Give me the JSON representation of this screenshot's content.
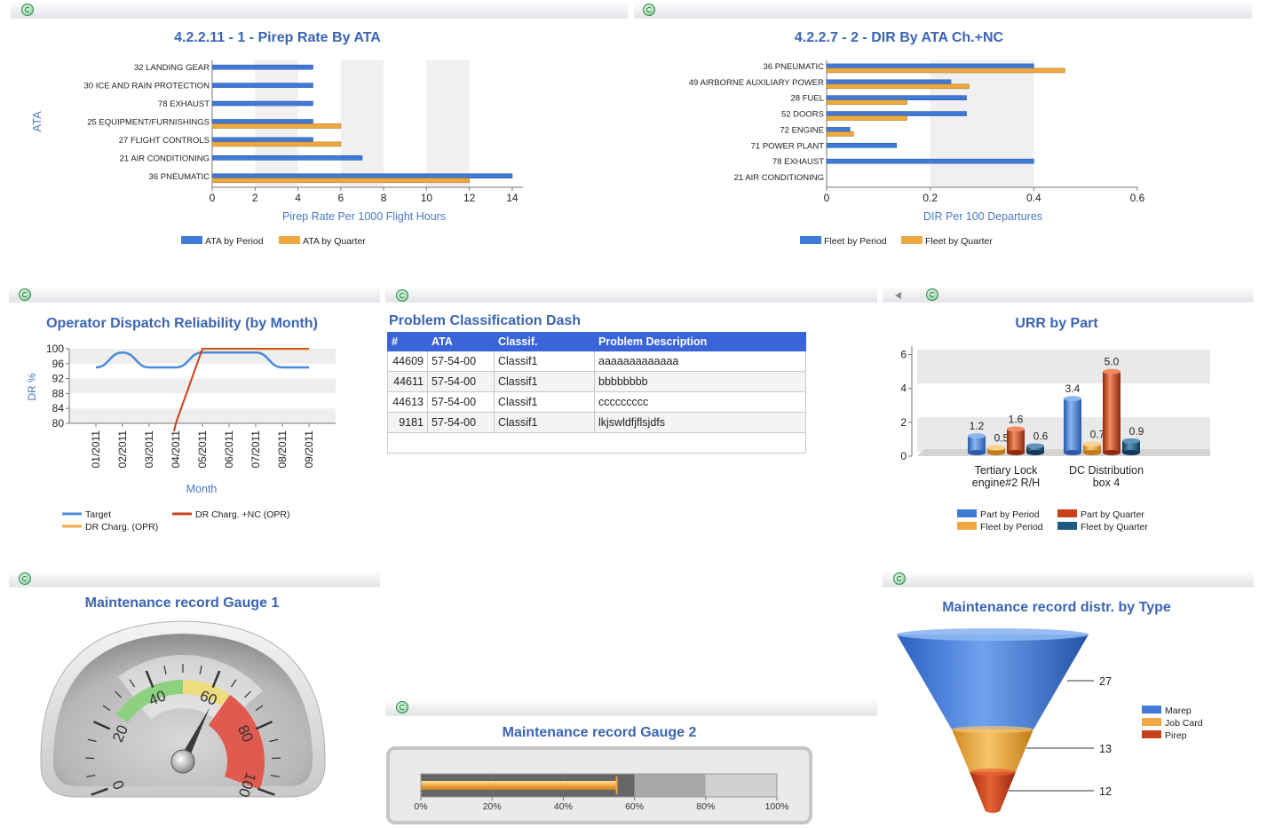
{
  "colors": {
    "title": "#3a65b4",
    "blue": "#3f7ad6",
    "orange": "#f0a840",
    "red": "#c9401a",
    "darkblue": "#1f5a84",
    "axis": "#4a78c4"
  },
  "pirep": {
    "title": "4.2.2.11 - 1 - Pirep Rate By ATA",
    "ylabel": "ATA",
    "xlabel": "Pirep Rate Per 1000 Flight Hours",
    "legend": [
      "ATA by Period",
      "ATA by Quarter"
    ],
    "chart_data": {
      "type": "bar",
      "categories": [
        "32 LANDING GEAR",
        "30 ICE AND RAIN PROTECTION",
        "78 EXHAUST",
        "25 EQUIPMENT/FURNISHINGS",
        "27 FLIGHT CONTROLS",
        "21 AIR CONDITIONING",
        "36 PNEUMATIC"
      ],
      "series": [
        {
          "name": "ATA by Period",
          "values": [
            4.7,
            4.7,
            4.7,
            4.7,
            4.7,
            7.0,
            14.0
          ]
        },
        {
          "name": "ATA by Quarter",
          "values": [
            0,
            0,
            0,
            6.0,
            6.0,
            0,
            12.0
          ]
        }
      ],
      "ticks": [
        "0",
        "2",
        "4",
        "6",
        "8",
        "10",
        "12",
        "14"
      ],
      "xlim": [
        0,
        14.5
      ]
    }
  },
  "dir": {
    "title": "4.2.2.7 - 2 - DIR By ATA Ch.+NC",
    "xlabel": "DIR Per 100 Departures",
    "legend": [
      "Fleet by Period",
      "Fleet by Quarter"
    ],
    "chart_data": {
      "type": "bar",
      "categories": [
        "36 PNEUMATIC",
        "49 AIRBORNE AUXILIARY POWER",
        "28 FUEL",
        "52 DOORS",
        "72 ENGINE",
        "71 POWER PLANT",
        "78 EXHAUST",
        "21 AIR CONDITIONING"
      ],
      "series": [
        {
          "name": "Fleet by Period",
          "values": [
            0.4,
            0.24,
            0.27,
            0.27,
            0.045,
            0.135,
            0.4,
            0
          ]
        },
        {
          "name": "Fleet by Quarter",
          "values": [
            0.46,
            0.275,
            0.155,
            0.155,
            0.052,
            0,
            0,
            0
          ]
        }
      ],
      "ticks": [
        "0",
        "0.2",
        "0.4",
        "0.6"
      ],
      "xlim": [
        0,
        0.6
      ]
    }
  },
  "odr": {
    "title": "Operator Dispatch Reliability (by Month)",
    "ylabel": "DR %",
    "xlabel": "Month",
    "legend": [
      "Target",
      "DR Charg. +NC (OPR)",
      "DR Charg. (OPR)"
    ],
    "chart_data": {
      "type": "line",
      "categories": [
        "01/2011",
        "02/2011",
        "03/2011",
        "04/2011",
        "05/2011",
        "06/2011",
        "07/2011",
        "08/2011",
        "09/2011"
      ],
      "yticks": [
        "100",
        "96",
        "92",
        "88",
        "84",
        "80"
      ],
      "ylim": [
        80,
        100
      ],
      "series": [
        {
          "name": "Target",
          "values": [
            95,
            99,
            95,
            95,
            99,
            99,
            99,
            95,
            95
          ]
        },
        {
          "name": "DR Charg. +NC (OPR)",
          "values": [
            null,
            null,
            null,
            80,
            100,
            100,
            100,
            100,
            100
          ]
        },
        {
          "name": "DR Charg. (OPR)",
          "values": [
            null,
            null,
            null,
            null,
            100,
            100,
            100,
            100,
            100
          ]
        }
      ]
    }
  },
  "problems": {
    "title": "Problem Classification Dash",
    "columns": [
      "#",
      "ATA",
      "Classif.",
      "Problem Description"
    ],
    "rows": [
      [
        "44609",
        "57-54-00",
        "Classif1",
        "aaaaaaaaaaaaa"
      ],
      [
        "44611",
        "57-54-00",
        "Classif1",
        "bbbbbbbb"
      ],
      [
        "44613",
        "57-54-00",
        "Classif1",
        "ccccccccc"
      ],
      [
        "9181",
        "57-54-00",
        "Classif1",
        "lkjswldfjflsjdfs"
      ]
    ]
  },
  "urr": {
    "title": "URR by Part",
    "legend": [
      "Part by Period",
      "Part by Quarter",
      "Fleet by Period",
      "Fleet by Quarter"
    ],
    "chart_data": {
      "type": "bar",
      "categories": [
        "Tertiary Lock engine#2 R/H",
        "DC Distribution box 4"
      ],
      "category_lines": [
        [
          "Tertiary Lock",
          "engine#2 R/H"
        ],
        [
          "DC Distribution",
          "box 4"
        ]
      ],
      "yticks": [
        "6",
        "4",
        "2",
        "0"
      ],
      "ylim": [
        0,
        6.5
      ],
      "series": [
        {
          "name": "Part by Period",
          "values": [
            1.2,
            3.4
          ],
          "labels": [
            "1.2",
            "3.4"
          ]
        },
        {
          "name": "Fleet by Period",
          "values": [
            0.5,
            0.7
          ],
          "labels": [
            "0.5",
            "0.7"
          ]
        },
        {
          "name": "Part by Quarter",
          "values": [
            1.6,
            5.0
          ],
          "labels": [
            "1.6",
            "5.0"
          ]
        },
        {
          "name": "Fleet by Quarter",
          "values": [
            0.6,
            0.9
          ],
          "labels": [
            "0.6",
            "0.9"
          ]
        }
      ]
    }
  },
  "gauge1": {
    "title": "Maintenance record Gauge 1",
    "ticks": [
      "0",
      "20",
      "40",
      "60",
      "80",
      "100"
    ],
    "value": 62
  },
  "gauge2": {
    "title": "Maintenance record Gauge 2",
    "ticks": [
      "0%",
      "20%",
      "40%",
      "60%",
      "80%",
      "100%"
    ],
    "value_percent": 55
  },
  "funnel": {
    "title": "Maintenance record distr. by Type",
    "legend": [
      "Marep",
      "Job Card",
      "Pirep"
    ],
    "chart_data": {
      "type": "funnel",
      "categories": [
        "Marep",
        "Job Card",
        "Pirep"
      ],
      "values": [
        27,
        13,
        12
      ],
      "labels": [
        "27",
        "13",
        "12"
      ]
    }
  }
}
